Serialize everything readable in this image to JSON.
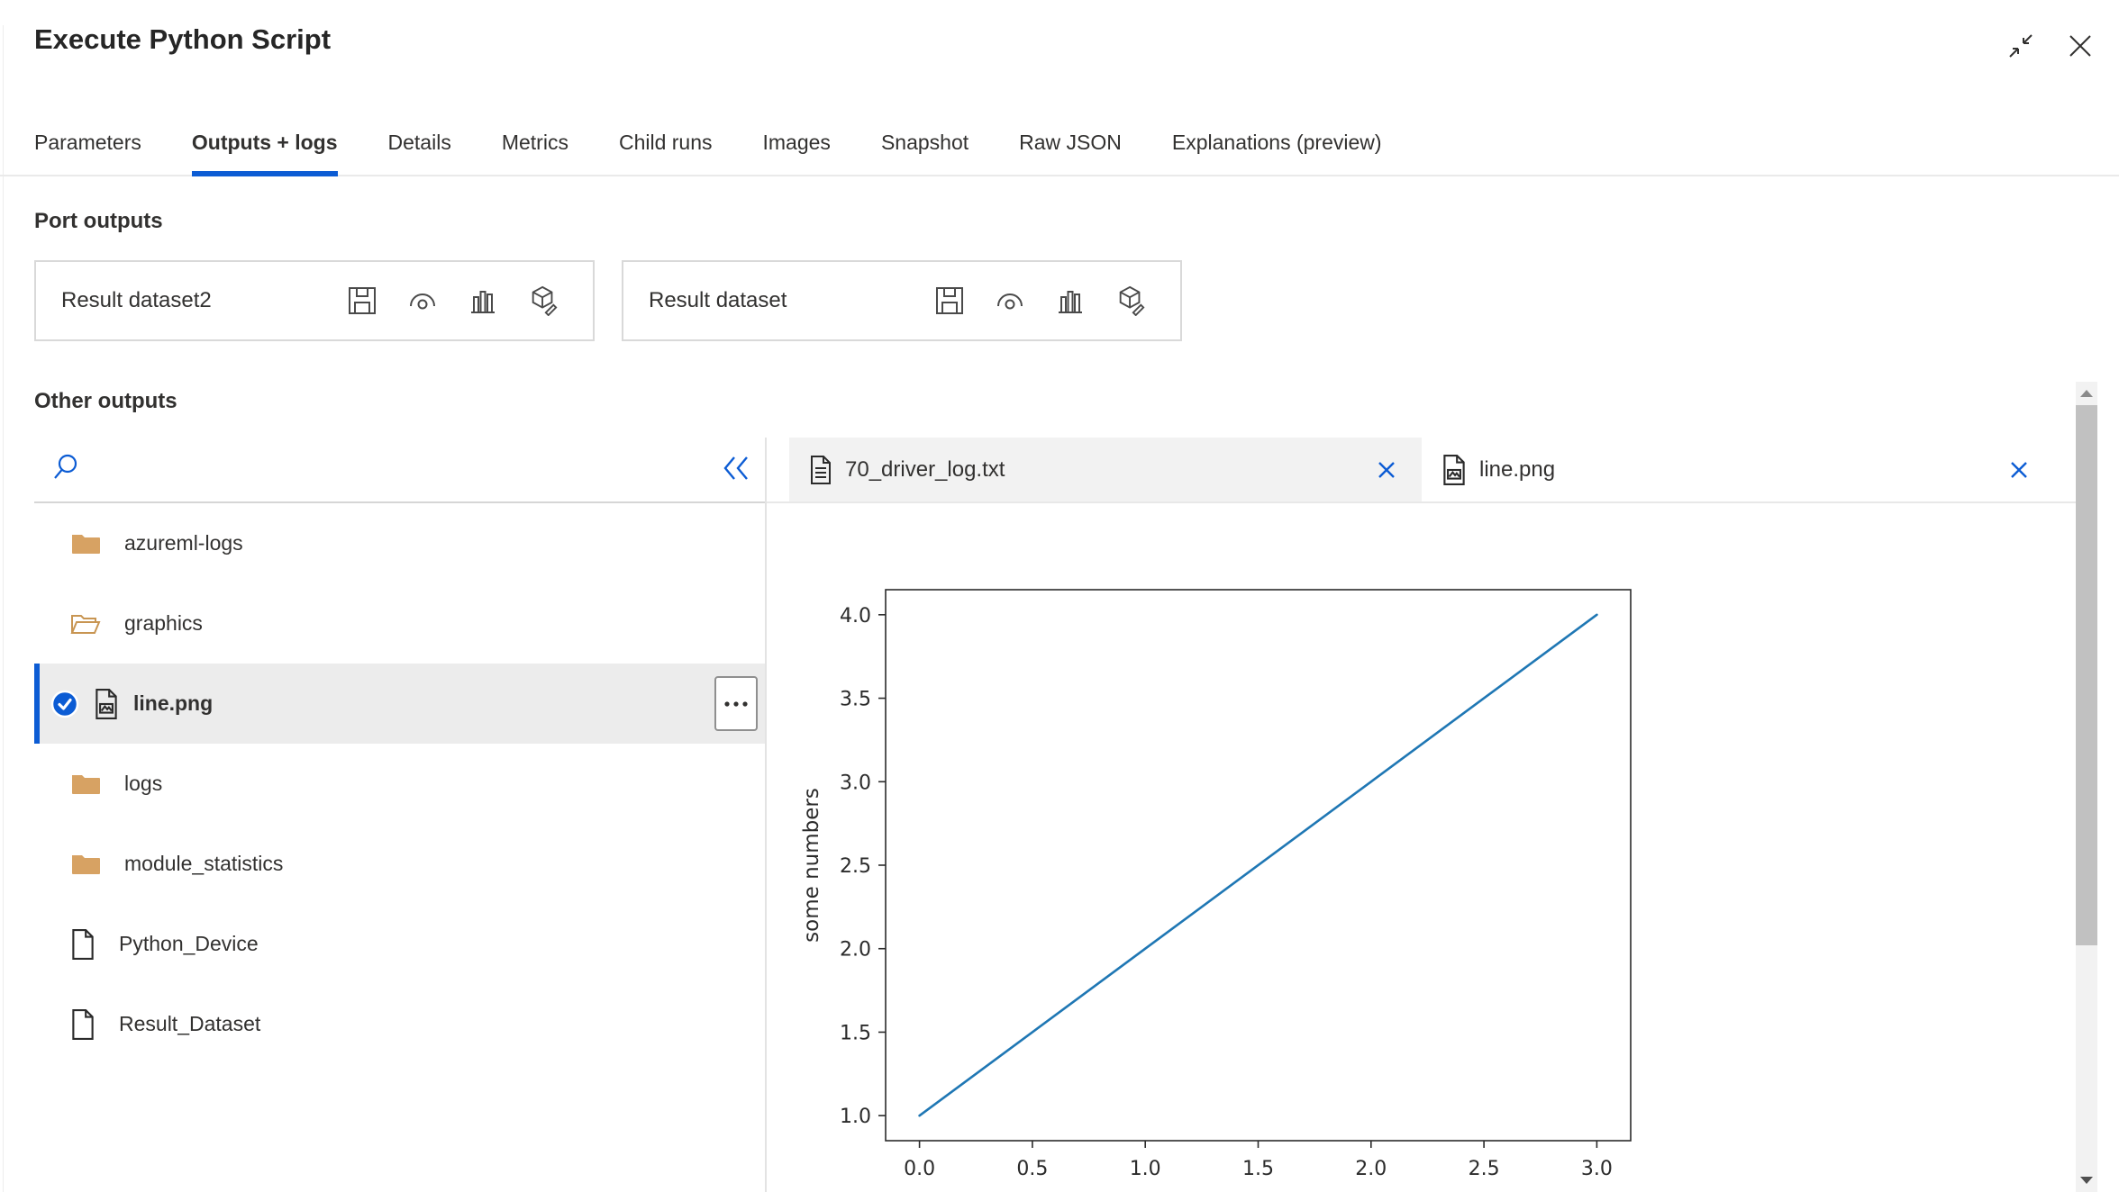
{
  "header": {
    "title": "Execute Python Script"
  },
  "window_controls": {
    "restore_icon": "arrow-minimize",
    "close_icon": "close"
  },
  "tabs": [
    {
      "label": "Parameters",
      "active": false
    },
    {
      "label": "Outputs + logs",
      "active": true
    },
    {
      "label": "Details",
      "active": false
    },
    {
      "label": "Metrics",
      "active": false
    },
    {
      "label": "Child runs",
      "active": false
    },
    {
      "label": "Images",
      "active": false
    },
    {
      "label": "Snapshot",
      "active": false
    },
    {
      "label": "Raw JSON",
      "active": false
    },
    {
      "label": "Explanations (preview)",
      "active": false
    }
  ],
  "port_outputs": {
    "heading": "Port outputs",
    "cards": [
      {
        "label": "Result dataset2",
        "icons": [
          "save-icon",
          "visualize-icon",
          "bar-chart-icon",
          "register-dataset-icon"
        ]
      },
      {
        "label": "Result dataset",
        "icons": [
          "save-icon",
          "visualize-icon",
          "bar-chart-icon",
          "register-dataset-icon"
        ]
      }
    ]
  },
  "other_outputs": {
    "heading": "Other outputs",
    "search_placeholder": "",
    "collapse_icon": "double-chevron-left",
    "tree": [
      {
        "name": "azureml-logs",
        "type": "folder",
        "selected": false
      },
      {
        "name": "graphics",
        "type": "folder-open",
        "selected": false
      },
      {
        "name": "line.png",
        "type": "image-file",
        "selected": true
      },
      {
        "name": "logs",
        "type": "folder",
        "selected": false
      },
      {
        "name": "module_statistics",
        "type": "folder",
        "selected": false
      },
      {
        "name": "Python_Device",
        "type": "file",
        "selected": false
      },
      {
        "name": "Result_Dataset",
        "type": "file",
        "selected": false
      }
    ]
  },
  "preview": {
    "tabs": [
      {
        "label": "70_driver_log.txt",
        "icon": "text-file-icon",
        "active": false
      },
      {
        "label": "line.png",
        "icon": "image-file-icon",
        "active": true
      }
    ]
  },
  "chart_data": {
    "type": "line",
    "title": "",
    "xlabel": "",
    "ylabel": "some numbers",
    "x": [
      0,
      1,
      2,
      3
    ],
    "y": [
      1,
      2,
      3,
      4
    ],
    "xticks": [
      0.0,
      0.5,
      1.0,
      1.5,
      2.0,
      2.5,
      3.0
    ],
    "yticks": [
      1.0,
      1.5,
      2.0,
      2.5,
      3.0,
      3.5,
      4.0
    ],
    "xlim": [
      -0.15,
      3.15
    ],
    "ylim": [
      0.85,
      4.15
    ],
    "grid": false,
    "legend": "none",
    "line_color": "#1f77b4"
  },
  "colors": {
    "accent": "#0c5cd4",
    "folder": "#d7a263",
    "folder_outline": "#c89552",
    "inactive_tab_bg": "#f2f2f2",
    "selected_row_bg": "#ececec",
    "text": "#323130",
    "chart_line": "#1f77b4"
  }
}
